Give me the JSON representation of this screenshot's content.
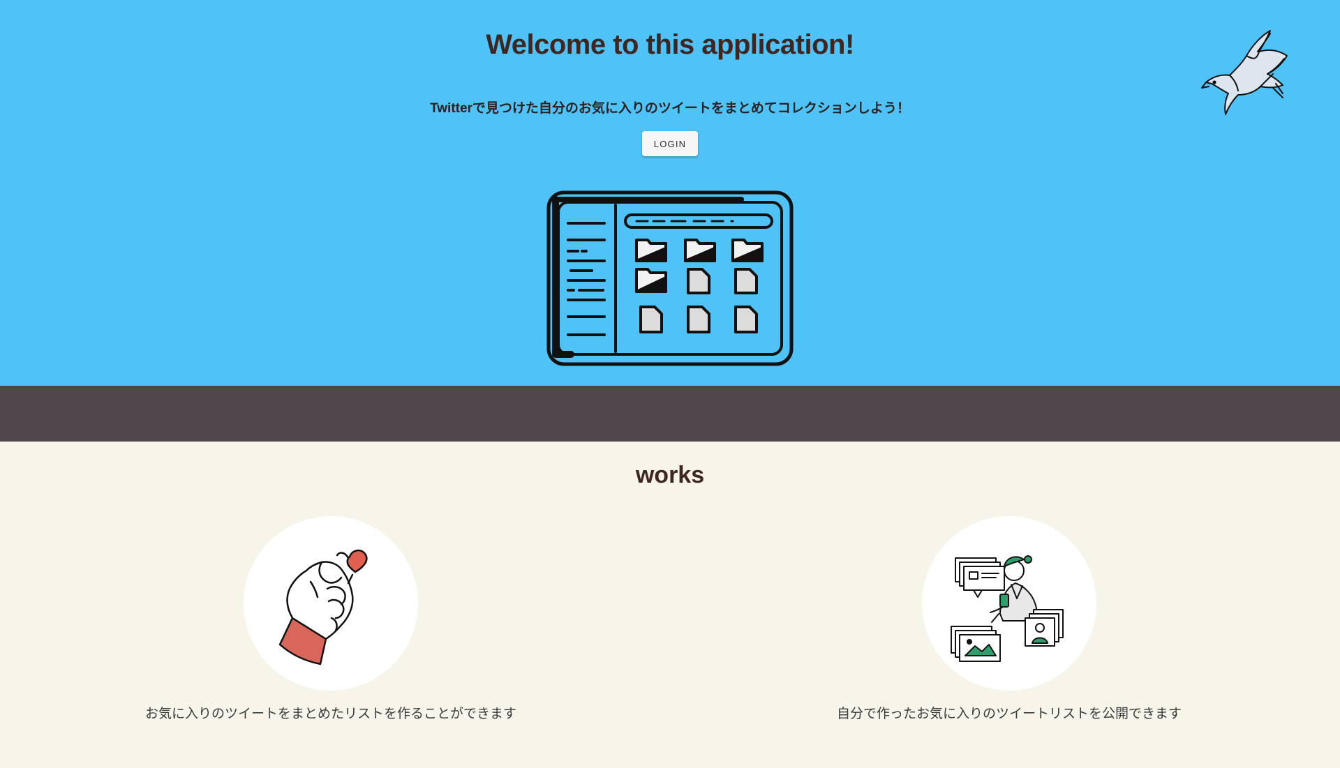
{
  "hero": {
    "title": "Welcome to this application!",
    "subtitle": "Twitterで見つけた自分のお気に入りのツイートをまとめてコレクションしよう！",
    "login_label": "LOGIN",
    "illustration_icon": "tablet-files-icon",
    "decoration_icon": "bird-icon"
  },
  "works": {
    "title": "works",
    "items": [
      {
        "icon": "finger-heart-icon",
        "caption": "お気に入りのツイートをまとめたリストを作ることができます"
      },
      {
        "icon": "person-sharing-icon",
        "caption": "自分で作ったお気に入りのツイートリストを公開できます"
      }
    ]
  },
  "colors": {
    "hero_bg": "#4FC3F7",
    "band_bg": "#50464B",
    "works_bg": "#F7F5E9",
    "title_text": "#3E2723",
    "heart": "#E06050",
    "accent_green": "#2E9E6B"
  }
}
